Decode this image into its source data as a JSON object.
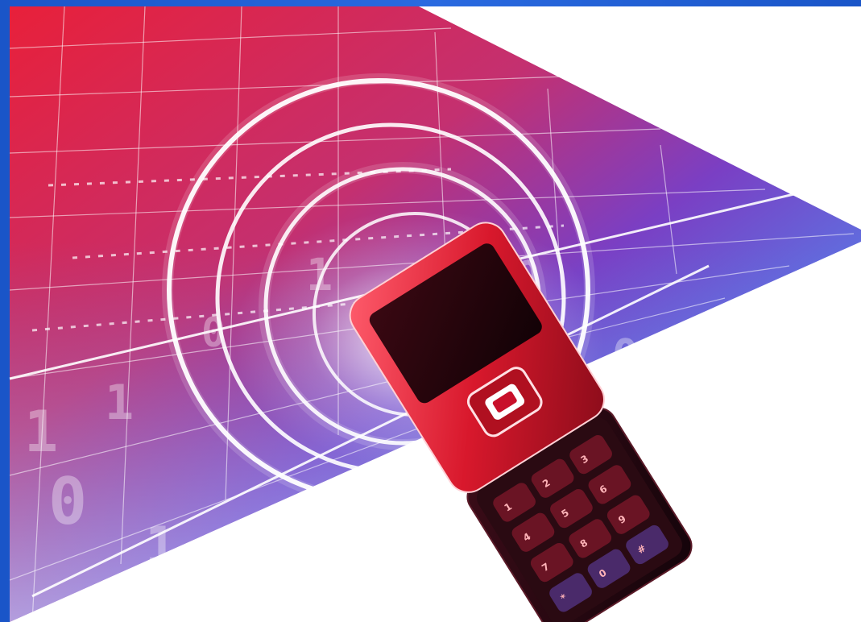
{
  "scene": {
    "subject": "phone-illustration",
    "colors": {
      "frame_blue": "#1f5fd6",
      "panel_red": "#e8203a",
      "panel_purple": "#7a3fc4",
      "panel_blue": "#4f8cf0",
      "background_white": "#ffffff",
      "phone_red": "#d8182c",
      "phone_dark": "#2a0a12",
      "ring_white": "#ffffff"
    },
    "phone": {
      "keypad": {
        "keys": [
          "1",
          "2",
          "3",
          "4",
          "5",
          "6",
          "7",
          "8",
          "9",
          "*",
          "0",
          "#"
        ]
      }
    },
    "background_digits": [
      "1",
      "0",
      "1",
      "1",
      "0",
      "1",
      "0",
      "0",
      "1"
    ]
  }
}
